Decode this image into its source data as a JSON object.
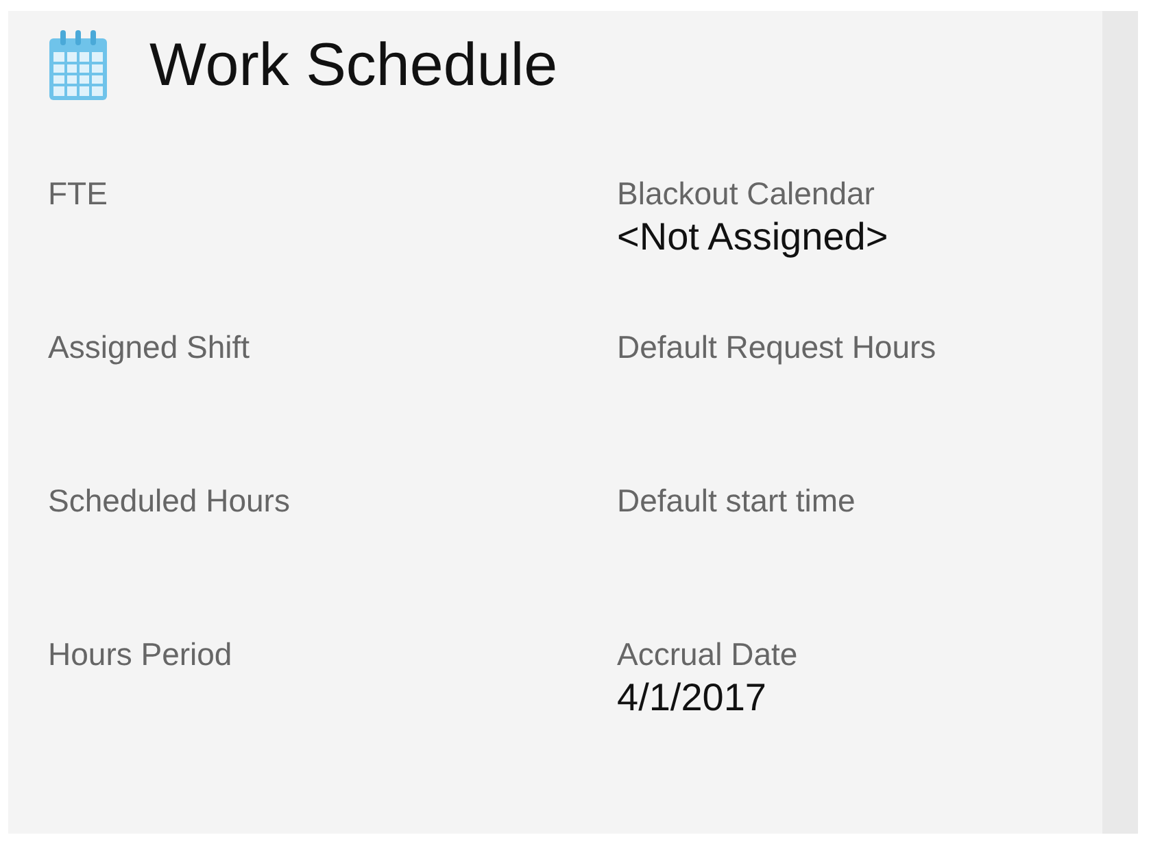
{
  "card": {
    "title": "Work Schedule",
    "fields": [
      {
        "label": "FTE"
      },
      {
        "label": "Blackout Calendar",
        "value": "<Not Assigned>"
      },
      {
        "label": "Assigned Shift"
      },
      {
        "label": "Default Request Hours"
      },
      {
        "label": "Scheduled Hours"
      },
      {
        "label": "Default start time"
      },
      {
        "label": "Hours Period"
      },
      {
        "label": "Accrual Date",
        "value": "4/1/2017"
      }
    ]
  }
}
